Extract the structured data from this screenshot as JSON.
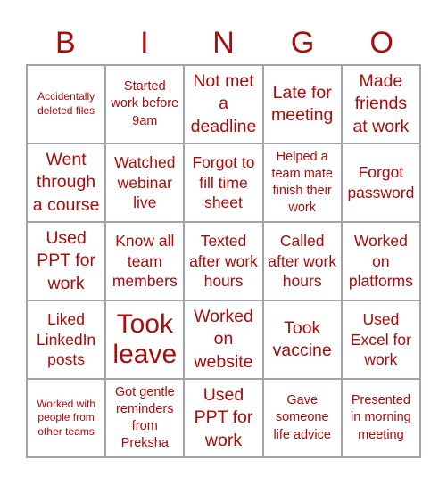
{
  "title_letters": [
    "B",
    "I",
    "N",
    "G",
    "O"
  ],
  "colors": {
    "text": "#a80c0c",
    "border": "#a2a2aa",
    "background": "#ffffff"
  },
  "cells": [
    [
      "Accidentally deleted files",
      "Started work before 9am",
      "Not met a deadline",
      "Late for meeting",
      "Made friends at work"
    ],
    [
      "Went through a course",
      "Watched webinar live",
      "Forgot to fill time sheet",
      "Helped a team mate finish their work",
      "Forgot password"
    ],
    [
      "Used PPT for work",
      "Know all team members",
      "Texted after work hours",
      "Called after work hours",
      "Worked on platforms"
    ],
    [
      "Liked LinkedIn posts",
      "Took leave",
      "Worked on website",
      "Took vaccine",
      "Used Excel for work"
    ],
    [
      "Worked with people from other teams",
      "Got gentle reminders from Preksha",
      "Used PPT for work",
      "Gave someone life advice",
      "Presented in morning meeting"
    ]
  ]
}
